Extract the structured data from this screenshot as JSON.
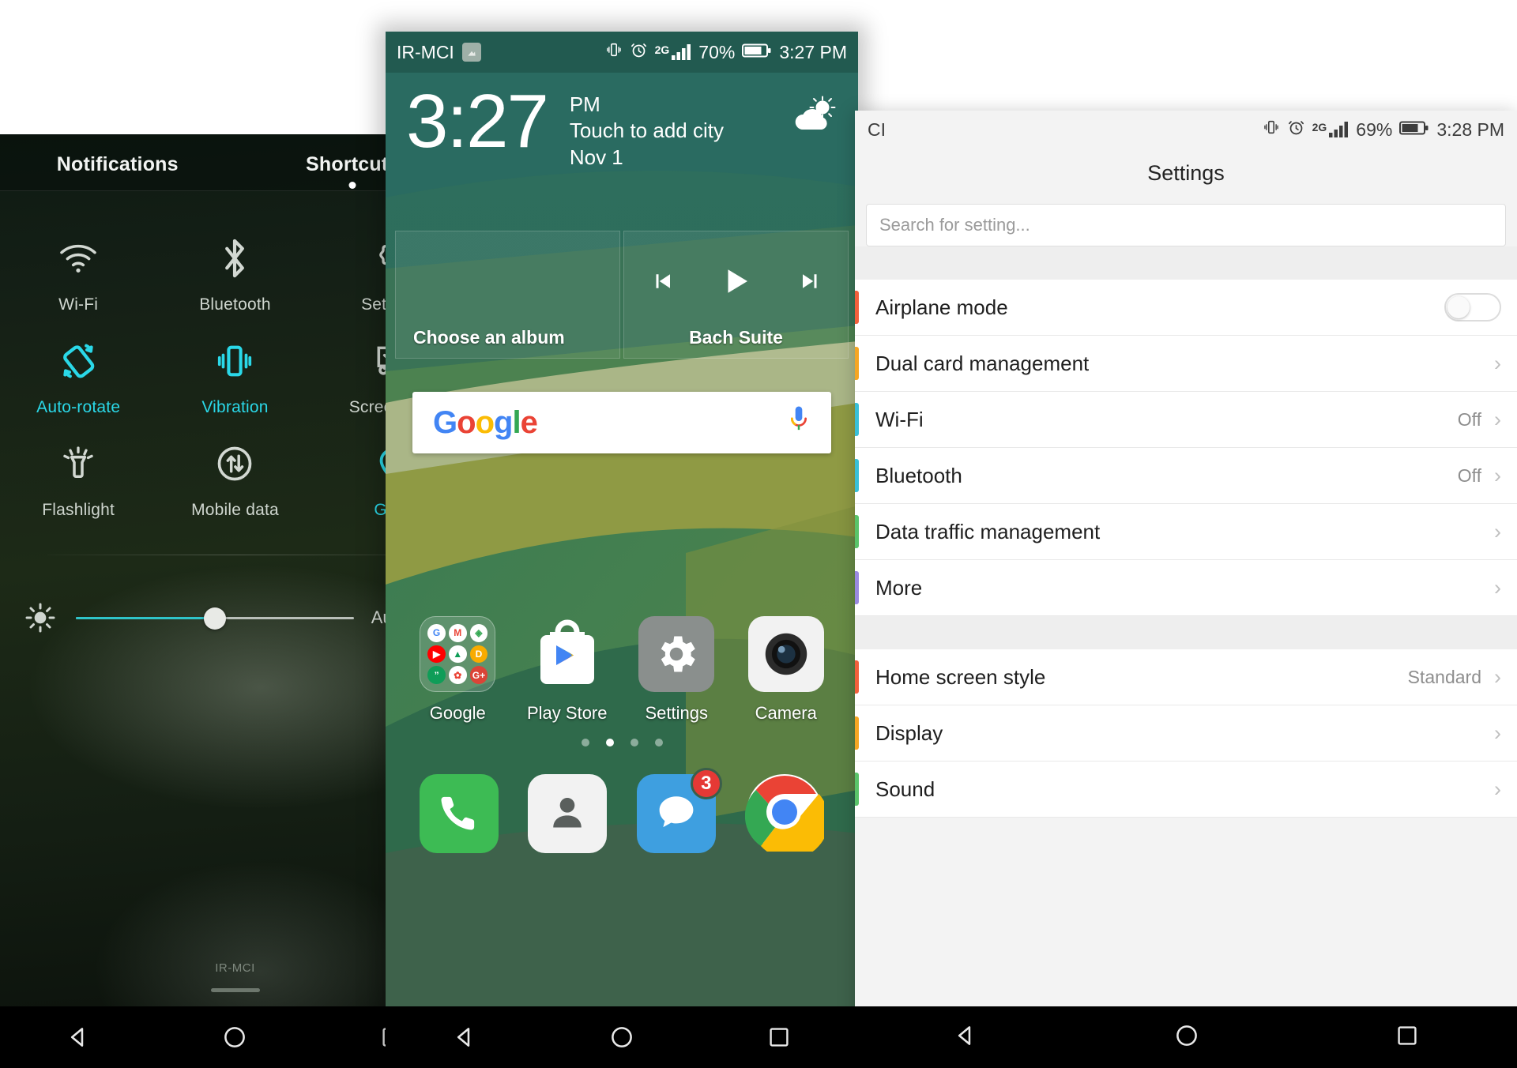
{
  "shade": {
    "tabs": [
      {
        "label": "Notifications",
        "active": false
      },
      {
        "label": "Shortcuts",
        "active": true
      }
    ],
    "tiles": [
      {
        "label": "Wi-Fi",
        "icon": "wifi-icon",
        "on": false
      },
      {
        "label": "Bluetooth",
        "icon": "bluetooth-icon",
        "on": false
      },
      {
        "label": "Settings",
        "icon": "gear-icon",
        "on": false
      },
      {
        "label": "Auto-rotate",
        "icon": "auto-rotate-icon",
        "on": true
      },
      {
        "label": "Vibration",
        "icon": "vibration-icon",
        "on": true
      },
      {
        "label": "Screenshot",
        "icon": "screenshot-icon",
        "on": false
      },
      {
        "label": "Flashlight",
        "icon": "flashlight-icon",
        "on": false
      },
      {
        "label": "Mobile data",
        "icon": "mobile-data-icon",
        "on": false
      },
      {
        "label": "GPS",
        "icon": "gps-icon",
        "on": true
      }
    ],
    "brightness": {
      "icon": "brightness-icon",
      "value_percent": 50,
      "auto_label": "Auto",
      "auto_checked": true
    },
    "carrier": "IR-MCI",
    "accent_color": "#2ad8e8"
  },
  "home": {
    "statusbar": {
      "carrier": "IR-MCI",
      "icons": [
        "sim-card-icon",
        "vibrate-icon",
        "alarm-icon",
        "2g-signal-icon"
      ],
      "network": "2G",
      "battery": "70%",
      "time": "3:27 PM"
    },
    "clock_widget": {
      "time": "3:27",
      "meridiem": "PM",
      "city_hint": "Touch to add city",
      "date": "Nov 1",
      "weather_icon": "partly-cloudy-icon"
    },
    "music_widget": {
      "album_label": "Choose an album",
      "track_label": "Bach Suite",
      "controls": [
        "previous-icon",
        "play-icon",
        "next-icon"
      ]
    },
    "search": {
      "logo": "Google",
      "logo_letters": [
        "G",
        "o",
        "o",
        "g",
        "l",
        "e"
      ],
      "mic_icon": "microphone-icon"
    },
    "apps": [
      {
        "name": "Google",
        "icon": "google-folder-icon"
      },
      {
        "name": "Play Store",
        "icon": "play-store-icon"
      },
      {
        "name": "Settings",
        "icon": "settings-gear-icon"
      },
      {
        "name": "Camera",
        "icon": "camera-icon"
      }
    ],
    "folder_apps": [
      "G",
      "M",
      "Maps",
      "YT",
      "Drive",
      "Duo",
      "Chat",
      "Photos",
      "G+"
    ],
    "page_dots": {
      "count": 4,
      "active_index": 1
    },
    "dock": [
      {
        "name": "phone-app",
        "icon": "phone-icon",
        "badge": null
      },
      {
        "name": "contacts-app",
        "icon": "person-icon",
        "badge": null
      },
      {
        "name": "messages-app",
        "icon": "message-icon",
        "badge": "3"
      },
      {
        "name": "chrome-app",
        "icon": "chrome-icon",
        "badge": null
      }
    ]
  },
  "settings": {
    "statusbar": {
      "carrier": "CI",
      "network": "2G",
      "battery": "69%",
      "time": "3:28 PM"
    },
    "title": "Settings",
    "search_placeholder": "Search for setting...",
    "group1": [
      {
        "label": "Airplane mode",
        "value": "",
        "control": "toggle",
        "toggle_on": false,
        "accent": "#f2603c"
      },
      {
        "label": "Dual card management",
        "value": "",
        "control": "chevron",
        "accent": "#f5a623"
      },
      {
        "label": "Wi-Fi",
        "value": "Off",
        "control": "chevron",
        "accent": "#39c0d8"
      },
      {
        "label": "Bluetooth",
        "value": "Off",
        "control": "chevron",
        "accent": "#39c0d8"
      },
      {
        "label": "Data traffic management",
        "value": "",
        "control": "chevron",
        "accent": "#5ac46a"
      },
      {
        "label": "More",
        "value": "",
        "control": "chevron",
        "accent": "#9a8ae0"
      }
    ],
    "group2": [
      {
        "label": "Home screen style",
        "value": "Standard",
        "control": "chevron",
        "accent": "#f2603c"
      },
      {
        "label": "Display",
        "value": "",
        "control": "chevron",
        "accent": "#f5a623"
      },
      {
        "label": "Sound",
        "value": "",
        "control": "chevron",
        "accent": "#5ac46a"
      }
    ]
  },
  "navbar": {
    "back": "back-triangle-icon",
    "home": "home-circle-icon",
    "recents": "recents-square-icon"
  }
}
